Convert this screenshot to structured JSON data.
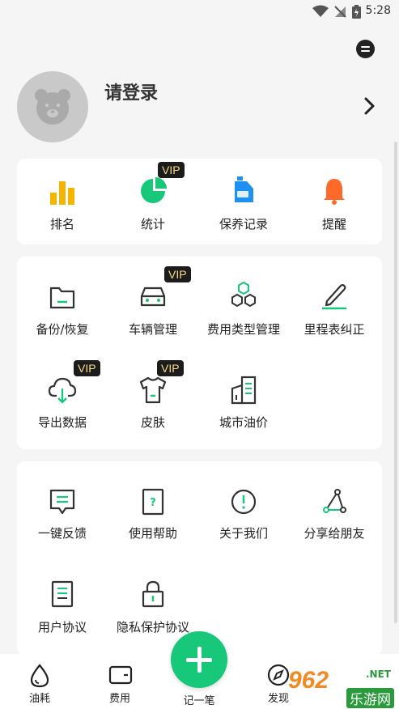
{
  "status_bar": {
    "time": "5:28"
  },
  "profile": {
    "login_label": "请登录"
  },
  "quick_card": {
    "items": [
      {
        "label": "排名",
        "icon": "bar-chart-icon"
      },
      {
        "label": "统计",
        "icon": "pie-chart-icon",
        "badge": "VIP"
      },
      {
        "label": "保养记录",
        "icon": "oil-bottle-icon"
      },
      {
        "label": "提醒",
        "icon": "bell-icon"
      }
    ]
  },
  "tools_card": {
    "items": [
      {
        "label": "备份/恢复",
        "icon": "folder-icon"
      },
      {
        "label": "车辆管理",
        "icon": "car-icon",
        "badge": "VIP"
      },
      {
        "label": "费用类型管理",
        "icon": "hexagons-icon"
      },
      {
        "label": "里程表纠正",
        "icon": "pencil-icon"
      },
      {
        "label": "导出数据",
        "icon": "cloud-download-icon",
        "badge": "VIP"
      },
      {
        "label": "皮肤",
        "icon": "tshirt-icon",
        "badge": "VIP"
      },
      {
        "label": "城市油价",
        "icon": "buildings-icon"
      }
    ]
  },
  "help_card": {
    "items": [
      {
        "label": "一键反馈",
        "icon": "feedback-icon"
      },
      {
        "label": "使用帮助",
        "icon": "help-icon"
      },
      {
        "label": "关于我们",
        "icon": "info-icon"
      },
      {
        "label": "分享给朋友",
        "icon": "share-icon"
      },
      {
        "label": "用户协议",
        "icon": "document-icon"
      },
      {
        "label": "隐私保护协议",
        "icon": "lock-icon"
      }
    ]
  },
  "tab_bar": {
    "tabs": [
      {
        "label": "油耗",
        "icon": "drop-icon"
      },
      {
        "label": "费用",
        "icon": "wallet-icon"
      },
      {
        "label": "发现",
        "icon": "compass-icon"
      }
    ],
    "add_label": "记一笔"
  },
  "watermark": {
    "brand": "962",
    "domain": ".NET",
    "sub": "乐游网"
  },
  "colors": {
    "accent": "#17c77a",
    "vip_bg": "#1c1c1c",
    "vip_text": "#f7d98b",
    "bell": "#ff6a2a",
    "chart": "#f5b400"
  }
}
